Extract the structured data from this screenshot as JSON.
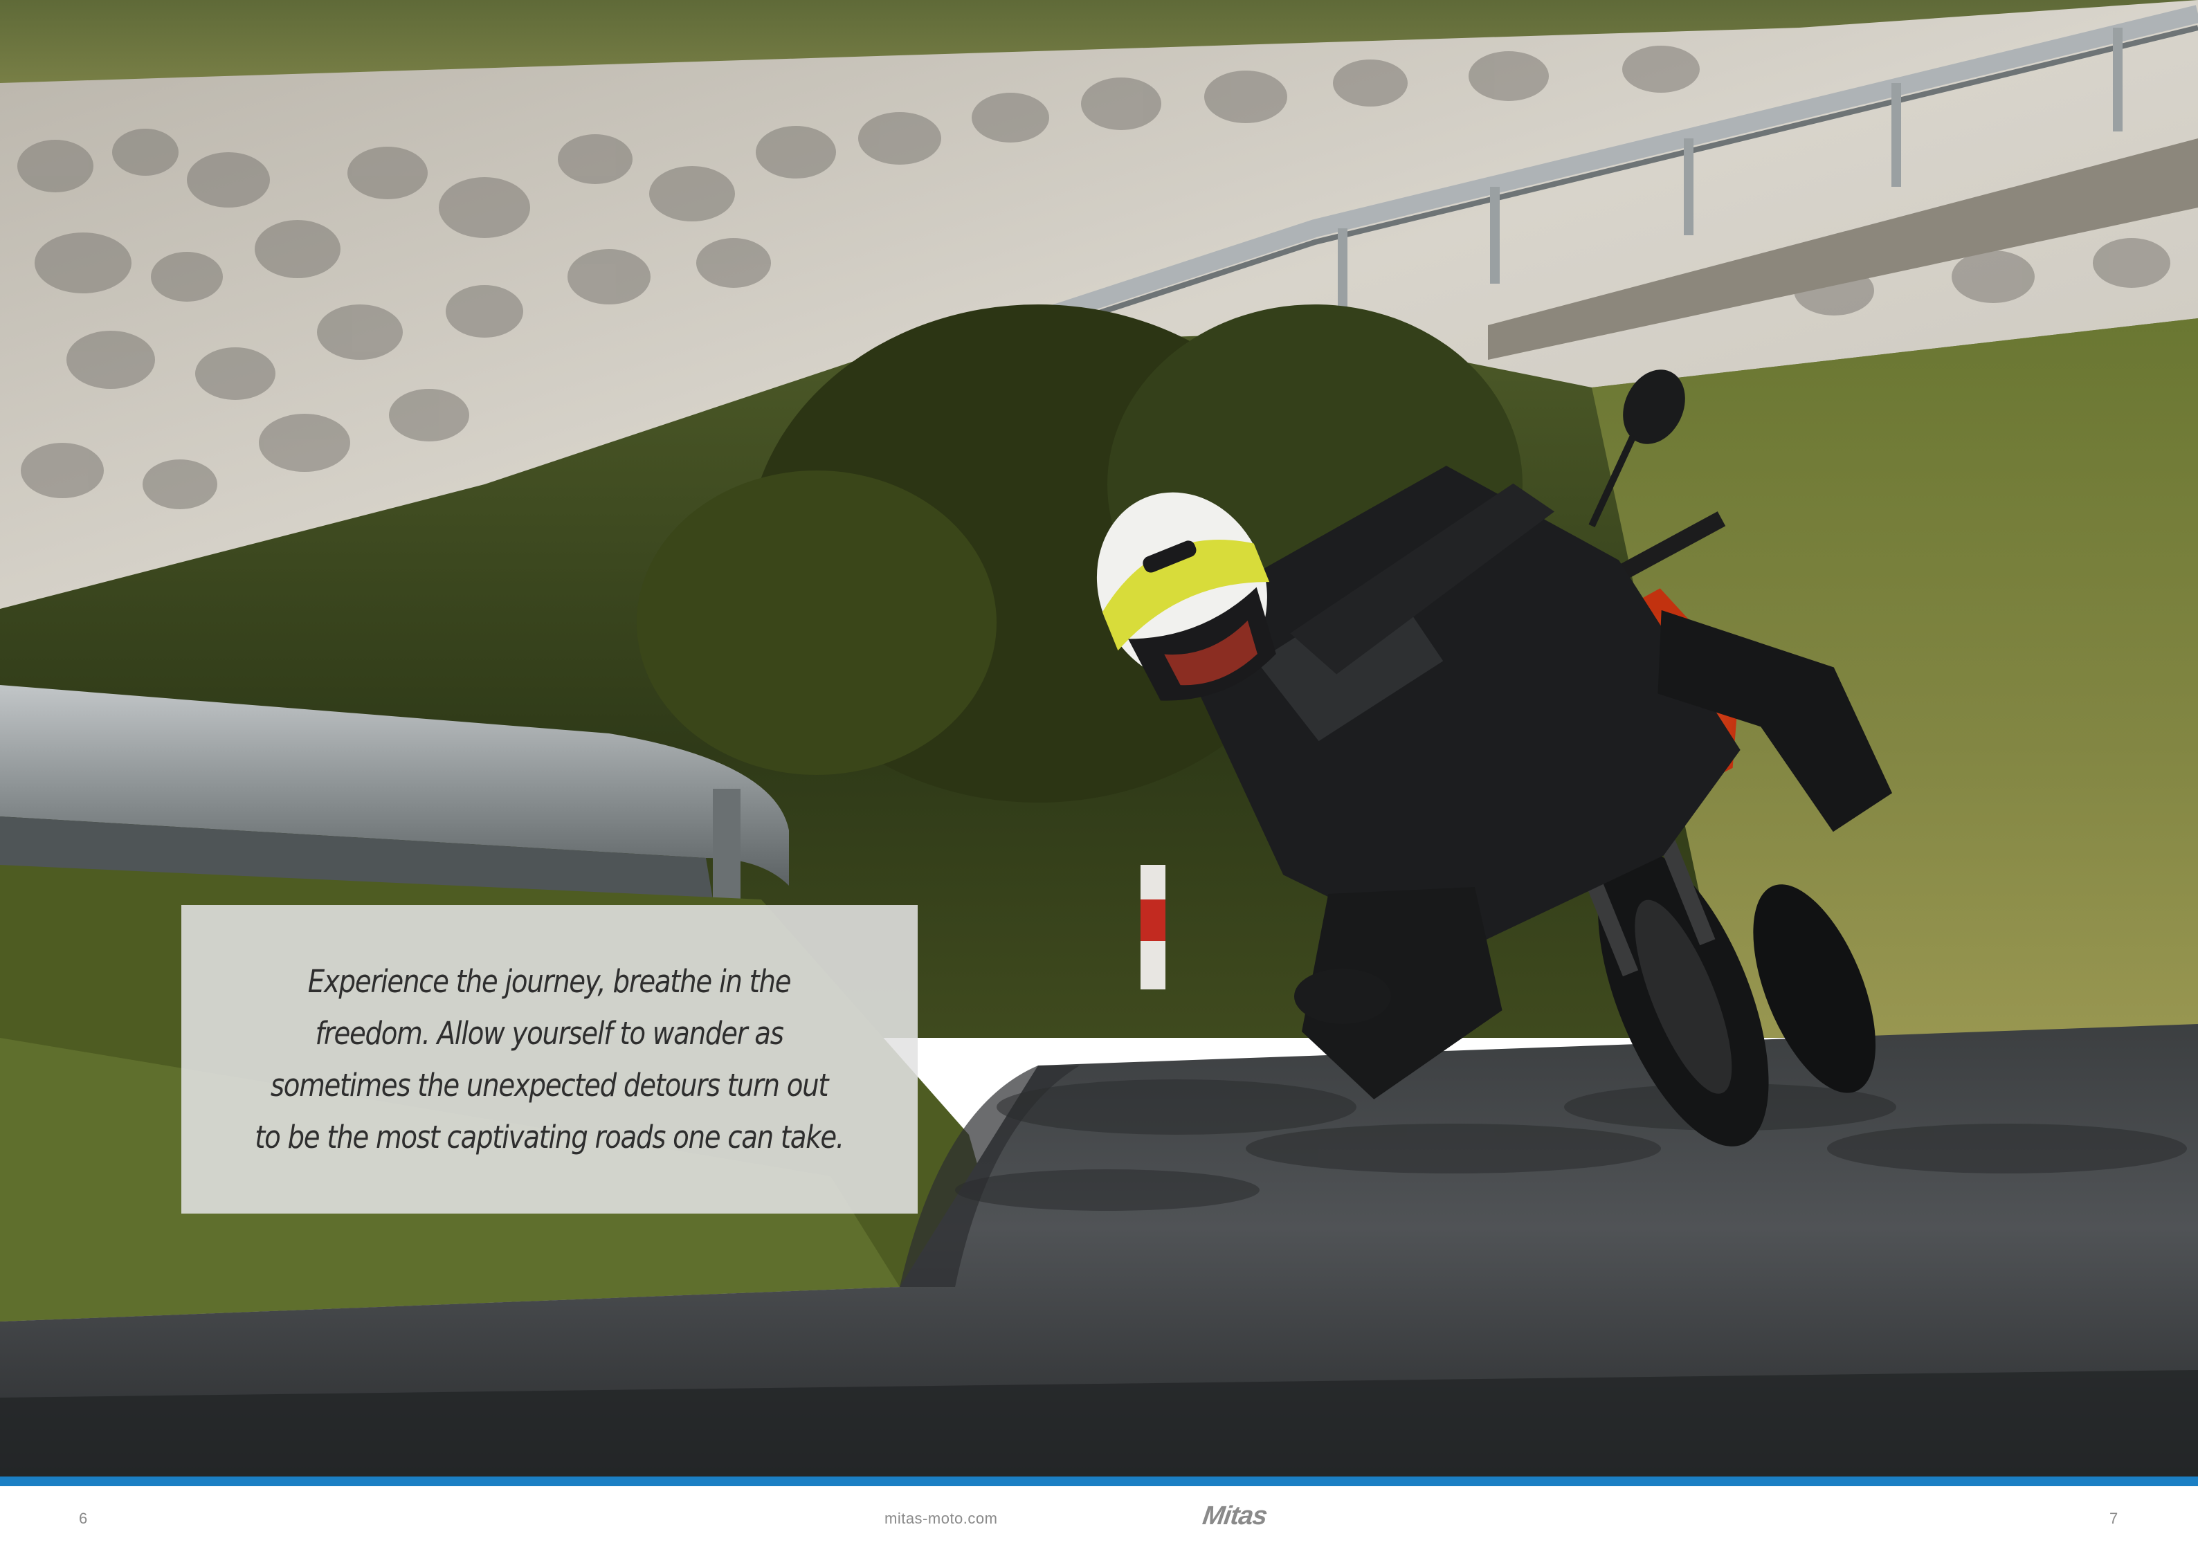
{
  "quote": {
    "lines": [
      "Experience the journey, breathe in the",
      "freedom. Allow yourself to wander as",
      "sometimes the unexpected detours turn out",
      "to be the most captivating roads one can take."
    ]
  },
  "footer": {
    "page_left": "6",
    "url": "mitas-moto.com",
    "logo": "Mitas",
    "page_right": "7"
  },
  "colors": {
    "accent": "#1b7fc4",
    "bike": "#e0461c"
  }
}
